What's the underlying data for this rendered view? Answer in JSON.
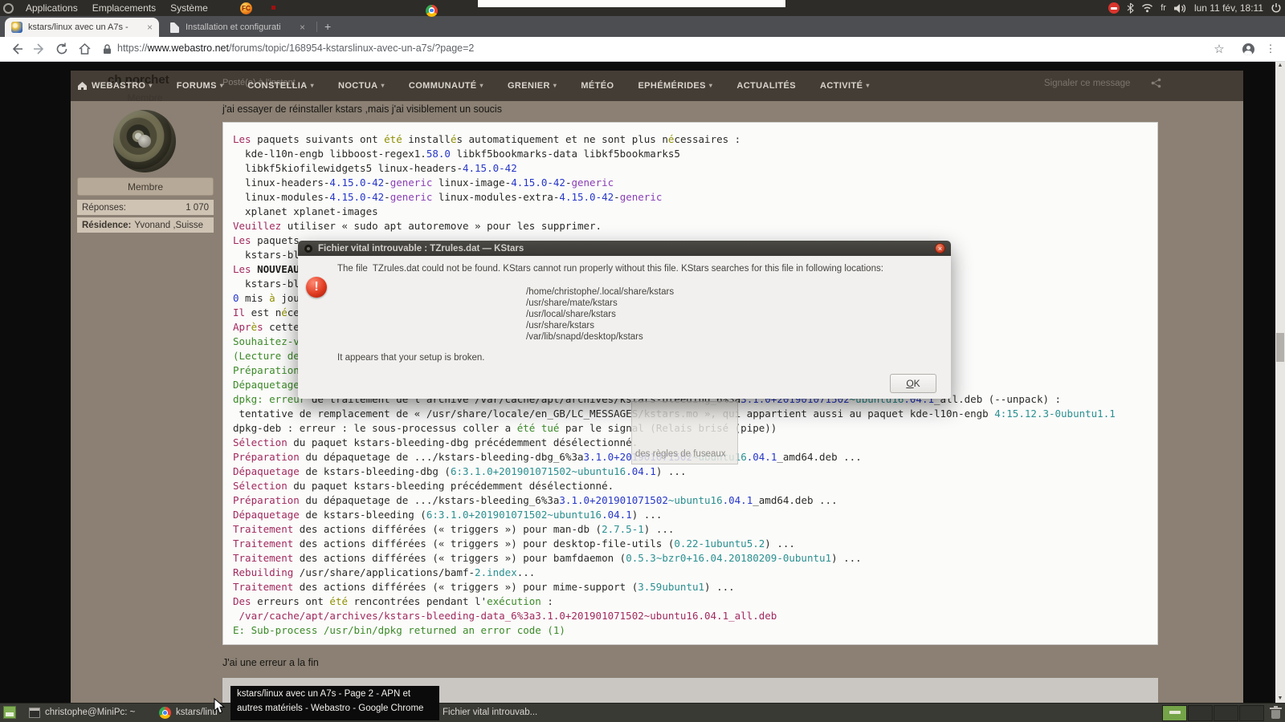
{
  "panel": {
    "menus": [
      "Applications",
      "Emplacements",
      "Système"
    ],
    "keyboard_layout": "fr",
    "clock": "lun 11 fév, 18:11",
    "tray_icons": [
      "do-not-disturb",
      "bluetooth",
      "wifi",
      "volume",
      "power"
    ]
  },
  "chrome": {
    "tabs": [
      {
        "title": "kstars/linux avec un A7s -",
        "close": "×"
      },
      {
        "title": "Installation et configurati",
        "close": "×"
      }
    ],
    "new_tab": "+",
    "url": {
      "scheme": "https://",
      "host": "www.webastro.net",
      "path": "/forums/topic/168954-kstarslinux-avec-un-a7s/?page=2"
    },
    "window_controls": {
      "minimize": "–",
      "maximize": "▢",
      "close": "×"
    }
  },
  "forum": {
    "nav_items": [
      {
        "label": "WEBASTRO",
        "caret": true
      },
      {
        "label": "FORUMS",
        "caret": true
      },
      {
        "label": "CONSTELLIA",
        "caret": true
      },
      {
        "label": "NOCTUA",
        "caret": true
      },
      {
        "label": "COMMUNAUTÉ",
        "caret": true
      },
      {
        "label": "GRENIER",
        "caret": true
      },
      {
        "label": "MÉTÉO",
        "caret": false
      },
      {
        "label": "EPHÉMÉRIDES",
        "caret": true
      },
      {
        "label": "ACTUALITÉS",
        "caret": false
      },
      {
        "label": "ACTIVITÉ",
        "caret": true
      }
    ],
    "username": "ch porchet",
    "member_under_name": "Membre",
    "posted": "Posté(e) à l'instant",
    "report": "Signaler ce message",
    "badge": "Membre",
    "stats": [
      {
        "label": "Réponses:",
        "value": "1 070"
      },
      {
        "label": "Résidence:",
        "value": "Yvonand ,Suisse"
      }
    ],
    "post_intro": "j'ai essayer de réinstaller kstars ,mais j'ai visiblement un soucis",
    "post_outro": "J'ai une erreur a la fin",
    "code_lines": [
      [
        [
          "Les",
          "k"
        ],
        [
          " paquets suivants ont ",
          "d"
        ],
        [
          "été",
          "o"
        ],
        [
          " install",
          "d"
        ],
        [
          "é",
          "o"
        ],
        [
          "s automatiquement et ne sont plus n",
          "d"
        ],
        [
          "é",
          "o"
        ],
        [
          "cessaires :",
          "d"
        ]
      ],
      [
        [
          "  kde-l10n-engb libboost-regex1.",
          "d"
        ],
        [
          "58.0",
          "n"
        ],
        [
          " libkf5bookmarks-data libkf5bookmarks5",
          "d"
        ]
      ],
      [
        [
          "  libkf5kiofilewidgets5 linux-headers-",
          "d"
        ],
        [
          "4.15.0-42",
          "n"
        ]
      ],
      [
        [
          "  linux-headers-",
          "d"
        ],
        [
          "4.15.0-42",
          "n"
        ],
        [
          "-",
          "d"
        ],
        [
          "generic",
          "p"
        ],
        [
          " linux-image-",
          "d"
        ],
        [
          "4.15.0-42",
          "n"
        ],
        [
          "-",
          "d"
        ],
        [
          "generic",
          "p"
        ]
      ],
      [
        [
          "  linux-modules-",
          "d"
        ],
        [
          "4.15.0-42",
          "n"
        ],
        [
          "-",
          "d"
        ],
        [
          "generic",
          "p"
        ],
        [
          " linux-modules-extra-",
          "d"
        ],
        [
          "4.15.0-42",
          "n"
        ],
        [
          "-",
          "d"
        ],
        [
          "generic",
          "p"
        ]
      ],
      [
        [
          "  xplanet xplanet-images",
          "d"
        ]
      ],
      [
        [
          "Veuillez",
          "k"
        ],
        [
          " utiliser « sudo apt autoremove » pour les supprimer.",
          "d"
        ]
      ],
      [
        [
          "Les",
          "k"
        ],
        [
          " paquets",
          "d"
        ]
      ],
      [
        [
          "  kstars-ble",
          "d"
        ]
      ],
      [
        [
          "Les",
          "k"
        ],
        [
          " ",
          "d"
        ],
        [
          "NOUVEAUX",
          "b"
        ]
      ],
      [
        [
          "  kstars-ble",
          "d"
        ]
      ],
      [
        [
          "0",
          "n"
        ],
        [
          " mis ",
          "d"
        ],
        [
          "à",
          "o"
        ],
        [
          " jour",
          "d"
        ]
      ],
      [
        [
          "Il",
          "k"
        ],
        [
          " est n",
          "d"
        ],
        [
          "é",
          "o"
        ],
        [
          "ces",
          "d"
        ]
      ],
      [
        [
          "Apr",
          "k"
        ],
        [
          "è",
          "o"
        ],
        [
          "s",
          "k"
        ],
        [
          " cette",
          "d"
        ]
      ],
      [
        [
          "Souhaitez-vo",
          "g"
        ]
      ],
      [
        [
          "(Lecture de",
          "g"
        ]
      ],
      [
        [
          "Préparation",
          "g"
        ]
      ],
      [
        [
          "Dépaquetage",
          "g"
        ]
      ],
      [
        [
          "dpkg: erreur",
          "g"
        ],
        [
          " de traitement de l'archive /var/cache/apt/archives/kstars-bleeding_6%3a",
          "d"
        ],
        [
          "3.1.0+201901071502",
          "n"
        ],
        [
          "~ubuntu16",
          "t"
        ],
        [
          ".04.1",
          "n"
        ],
        [
          "_all.deb (--unpack) :",
          "d"
        ]
      ],
      [
        [
          " tentative de remplacement de « /usr/share/locale/en_GB/LC_MESSAGES/kstars.mo », qui appartient aussi au paquet kde-l10n-engb ",
          "d"
        ],
        [
          "4:15.12.3-0ubuntu1.1",
          "t"
        ]
      ],
      [
        [
          "dpkg-deb : erreur : le sous-processus coller a ",
          "d"
        ],
        [
          "été tué",
          "g"
        ],
        [
          " par le signal (Relais brisé (pipe))",
          "d"
        ]
      ],
      [
        [
          "Sélection",
          "k"
        ],
        [
          " du paquet kstars-bleeding-dbg précédemment désélectionné.",
          "d"
        ]
      ],
      [
        [
          "Préparation",
          "k"
        ],
        [
          " du dépaquetage de .../kstars-bleeding-dbg_6%3a",
          "d"
        ],
        [
          "3.1.0+201901071502",
          "n"
        ],
        [
          "~ubuntu16",
          "t"
        ],
        [
          ".04.1",
          "n"
        ],
        [
          "_amd64.deb ...",
          "d"
        ]
      ],
      [
        [
          "Dépaquetage",
          "k"
        ],
        [
          " de kstars-bleeding-dbg (",
          "d"
        ],
        [
          "6:3.1.0+201901071502~ubuntu16",
          "t"
        ],
        [
          ".04.1",
          "n"
        ],
        [
          ") ...",
          "d"
        ]
      ],
      [
        [
          "Sélection",
          "k"
        ],
        [
          " du paquet kstars-bleeding précédemment désélectionné.",
          "d"
        ]
      ],
      [
        [
          "Préparation",
          "k"
        ],
        [
          " du dépaquetage de .../kstars-bleeding_6%3a",
          "d"
        ],
        [
          "3.1.0+201901071502",
          "n"
        ],
        [
          "~ubuntu16",
          "t"
        ],
        [
          ".04.1",
          "n"
        ],
        [
          "_amd64.deb ...",
          "d"
        ]
      ],
      [
        [
          "Dépaquetage",
          "k"
        ],
        [
          " de kstars-bleeding (",
          "d"
        ],
        [
          "6:3.1.0+201901071502~ubuntu16",
          "t"
        ],
        [
          ".04.1",
          "n"
        ],
        [
          ") ...",
          "d"
        ]
      ],
      [
        [
          "Traitement",
          "k"
        ],
        [
          " des actions différées (« triggers ») pour man-db (",
          "d"
        ],
        [
          "2.7.5-1",
          "t"
        ],
        [
          ") ...",
          "d"
        ]
      ],
      [
        [
          "Traitement",
          "k"
        ],
        [
          " des actions différées (« triggers ») pour desktop-file-utils (",
          "d"
        ],
        [
          "0.22-1ubuntu5.2",
          "t"
        ],
        [
          ") ...",
          "d"
        ]
      ],
      [
        [
          "Traitement",
          "k"
        ],
        [
          " des actions différées (« triggers ») pour bamfdaemon (",
          "d"
        ],
        [
          "0.5.3~bzr0+16.04.20180209-0ubuntu1",
          "t"
        ],
        [
          ") ...",
          "d"
        ]
      ],
      [
        [
          "Rebuilding",
          "k"
        ],
        [
          " /usr/share/applications/bamf-",
          "d"
        ],
        [
          "2.index",
          "t"
        ],
        [
          "...",
          "d"
        ]
      ],
      [
        [
          "Traitement",
          "k"
        ],
        [
          " des actions différées (« triggers ») pour mime-support (",
          "d"
        ],
        [
          "3.59ubuntu1",
          "t"
        ],
        [
          ") ...",
          "d"
        ]
      ],
      [
        [
          "Des",
          "k"
        ],
        [
          " erreurs ont ",
          "d"
        ],
        [
          "été",
          "o"
        ],
        [
          " rencontrées pendant l'",
          "d"
        ],
        [
          "exécution",
          "g"
        ],
        [
          " :",
          "d"
        ]
      ],
      [
        [
          " /var/cache/apt/archives/kstars-bleeding-data_6%3a3.1.0+201901071502~ubuntu16.04.1_all.deb",
          "k"
        ]
      ],
      [
        [
          "E: Sub-process /usr/bin/dpkg returned an error code (1)",
          "g"
        ]
      ]
    ]
  },
  "dialog": {
    "title": "Fichier vital introuvable : TZrules.dat — KStars",
    "message": "The file  TZrules.dat could not be found. KStars cannot run properly without this file. KStars searches for this file in following locations:",
    "paths": [
      "/home/christophe/.local/share/kstars",
      "/usr/share/mate/kstars",
      "/usr/local/share/kstars",
      "/usr/share/kstars",
      "/var/lib/snapd/desktop/kstars"
    ],
    "footer": "It appears that your setup is broken.",
    "ok": "OK",
    "close": "×"
  },
  "fragment_tooltip": "des règles de fuseaux",
  "taskbar": {
    "tasks": [
      {
        "label": "christophe@MiniPc: ~"
      },
      {
        "label": "kstars/linu"
      },
      {
        "label": "Fichier vital introuvab..."
      }
    ],
    "tooltip_lines": [
      "kstars/linux avec un A7s - Page 2 - APN et",
      "autres matériels - Webastro - Google Chrome"
    ],
    "workspaces": 4
  },
  "colors": {
    "panel_bg": "#2d2c28",
    "taskbar_bg": "#3a3a35",
    "page_tan": "#8b8073",
    "nav_bg": "#3e3832",
    "sidebar_row": "#cfc3b4",
    "dialog_bg": "#f1f0ee",
    "dialog_titlebar": "#393834",
    "code_keyword": "#a12a5e",
    "code_green": "#3c8a28",
    "code_number": "#2737c8",
    "code_teal": "#2b9090",
    "close_button": "#d14328",
    "workspace_active": "#74a348"
  }
}
